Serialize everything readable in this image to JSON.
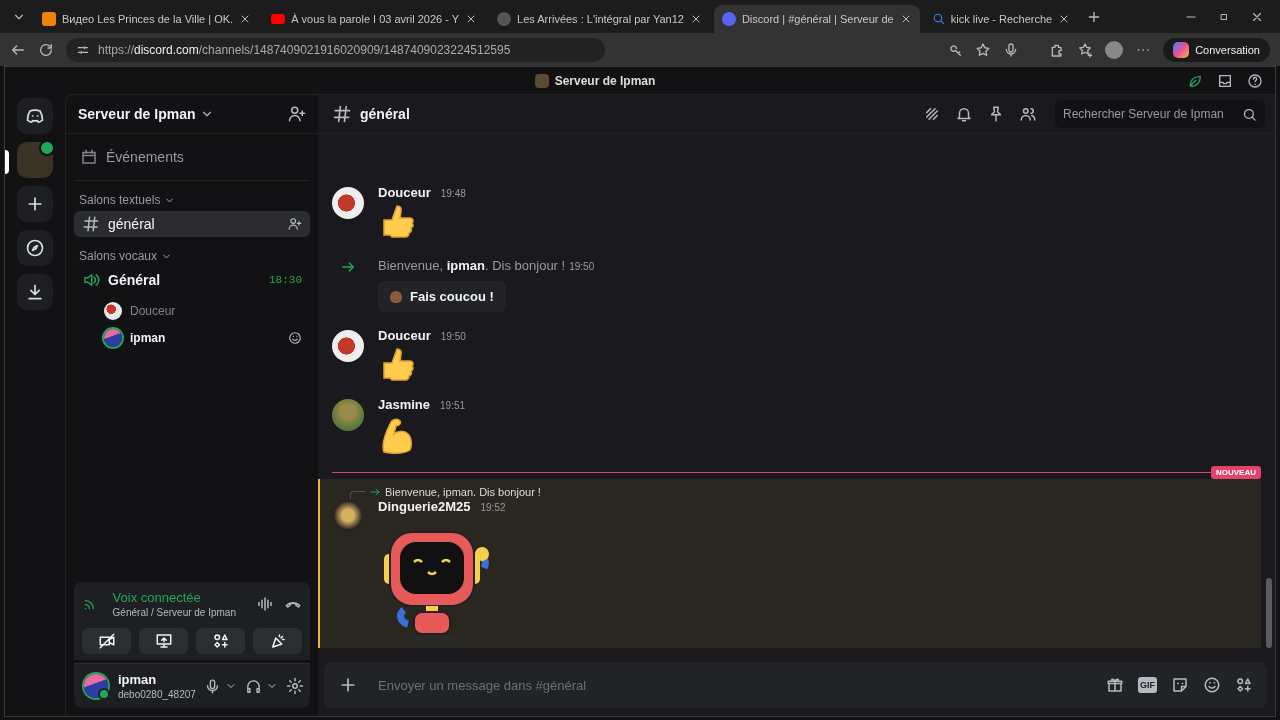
{
  "browser": {
    "tabs": [
      {
        "kind": "ok",
        "title": "Видео Les Princes de la Ville | OK.",
        "selected": false
      },
      {
        "kind": "youtube",
        "title": "À vous la parole I 03 avril 2026 - Y",
        "selected": false
      },
      {
        "kind": "generic",
        "title": "Les Arrivées : L'intégral par Yan12",
        "selected": false
      },
      {
        "kind": "discord",
        "title": "Discord | #général | Serveur de",
        "selected": true
      },
      {
        "kind": "search",
        "title": "kick live - Recherche",
        "selected": false
      }
    ],
    "url": "https://**discord.com**/channels/1487409021916020909/1487409023224512595",
    "profile_button": "Conversation"
  },
  "app_title": "Serveur de Ipman",
  "server_rail": [
    {
      "kind": "home",
      "selected": false
    },
    {
      "kind": "server",
      "selected": true
    },
    {
      "kind": "add",
      "selected": false
    },
    {
      "kind": "discover",
      "selected": false
    },
    {
      "kind": "download",
      "selected": false
    }
  ],
  "sidebar": {
    "server_name": "Serveur de Ipman",
    "events": "Événements",
    "categories": [
      {
        "name": "Salons textuels",
        "channels": [
          {
            "kind": "text",
            "name": "général",
            "selected": true
          }
        ]
      },
      {
        "name": "Salons vocaux",
        "channels": [
          {
            "kind": "voice",
            "name": "Général",
            "selected": false,
            "time": "18:30",
            "members": [
              {
                "name": "Douceur",
                "speaking": false
              },
              {
                "name": "ipman",
                "speaking": true
              }
            ]
          }
        ]
      }
    ]
  },
  "voice_panel": {
    "title": "Voix connectée",
    "subtitle": "Général / Serveur de Ipman"
  },
  "user_panel": {
    "name": "ipman",
    "tag": "debo0280_48207"
  },
  "chat": {
    "channel": "général",
    "search_placeholder": "Rechercher Serveur de Ipman",
    "messages": [
      {
        "kind": "message",
        "author": "Douceur",
        "time": "19:48",
        "content": {
          "kind": "thumbs_up"
        },
        "highlighted": false
      },
      {
        "kind": "system",
        "text": "Bienvenue, **ipman**. Dis bonjour !",
        "time": "19:50",
        "button": "Fais coucou !"
      },
      {
        "kind": "message",
        "author": "Douceur",
        "time": "19:50",
        "content": {
          "kind": "thumbs_up"
        },
        "highlighted": false
      },
      {
        "kind": "message",
        "author": "Jasmine",
        "time": "19:51",
        "content": {
          "kind": "flexed_arm"
        },
        "highlighted": false
      },
      {
        "kind": "divider",
        "label": "NOUVEAU"
      },
      {
        "kind": "message",
        "author": "Dinguerie2M25",
        "time": "19:52",
        "reply": "Bienvenue, ipman. Dis bonjour !",
        "content": {
          "kind": "sticker"
        },
        "highlighted": true
      }
    ],
    "composer": {
      "placeholder": "Envoyer un message dans #général",
      "gif_label": "GIF"
    }
  }
}
